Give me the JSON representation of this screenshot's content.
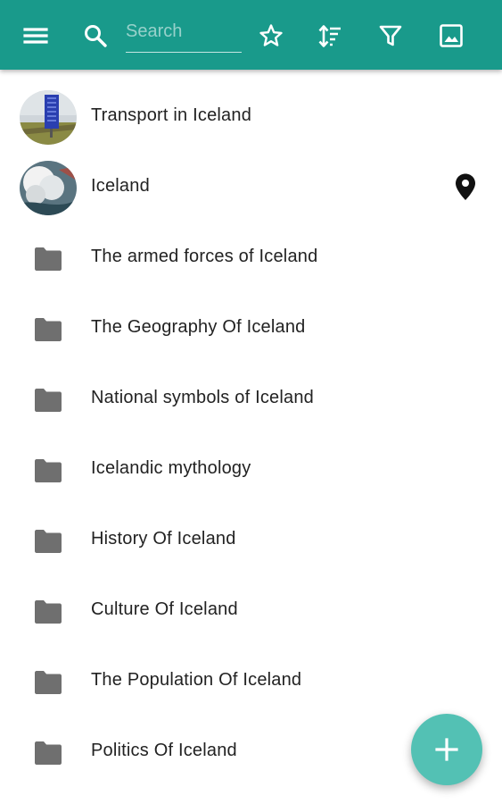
{
  "theme": {
    "toolbar_color": "#199a8b",
    "fab_color": "#53c1b4",
    "folder_icon_color": "#6f6f6f"
  },
  "toolbar": {
    "menu_icon": "menu-icon",
    "search_icon": "search-icon",
    "search_placeholder": "Search",
    "favorite_icon": "star-outline-icon",
    "sort_icon": "sort-icon",
    "filter_icon": "filter-icon",
    "gallery_icon": "image-icon"
  },
  "items": [
    {
      "label": "Transport in Iceland",
      "leading": "thumbnail"
    },
    {
      "label": "Iceland",
      "leading": "thumbnail",
      "trailing_icon": "map-pin-icon"
    },
    {
      "label": "The armed forces of Iceland",
      "leading": "folder-icon"
    },
    {
      "label": "The Geography Of Iceland",
      "leading": "folder-icon"
    },
    {
      "label": "National symbols of Iceland",
      "leading": "folder-icon"
    },
    {
      "label": "Icelandic mythology",
      "leading": "folder-icon"
    },
    {
      "label": "History Of Iceland",
      "leading": "folder-icon"
    },
    {
      "label": "Culture Of Iceland",
      "leading": "folder-icon"
    },
    {
      "label": "The Population Of Iceland",
      "leading": "folder-icon"
    },
    {
      "label": "Politics Of Iceland",
      "leading": "folder-icon"
    }
  ],
  "fab": {
    "icon": "plus-icon"
  }
}
